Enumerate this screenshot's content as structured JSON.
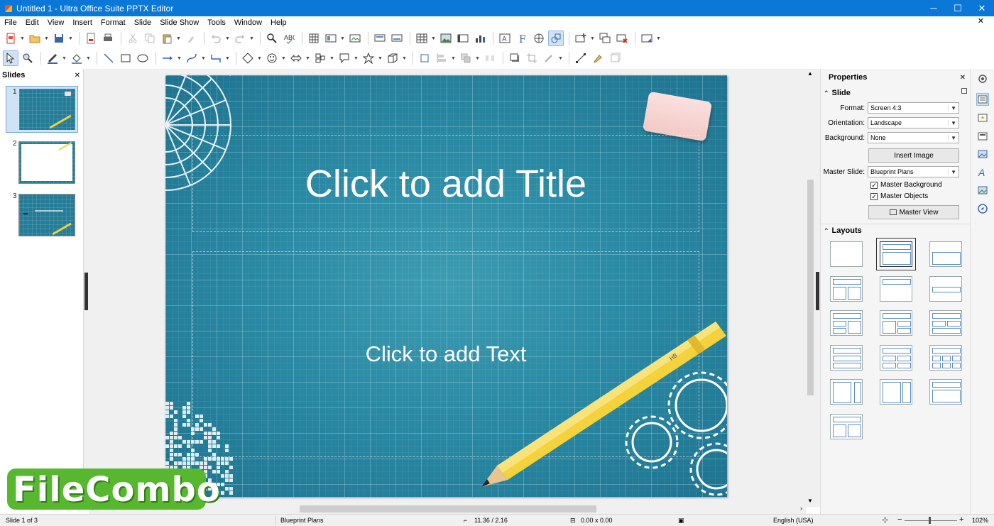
{
  "window": {
    "title": "Untitled 1 - Ultra Office Suite PPTX Editor",
    "minimize": "─",
    "maximize": "☐",
    "close": "✕"
  },
  "menu": {
    "items": [
      "File",
      "Edit",
      "View",
      "Insert",
      "Format",
      "Slide",
      "Slide Show",
      "Tools",
      "Window",
      "Help"
    ],
    "close": "✕"
  },
  "slides_pane": {
    "title": "Slides",
    "close": "✕",
    "thumbs": [
      {
        "number": "1"
      },
      {
        "number": "2"
      },
      {
        "number": "3"
      }
    ]
  },
  "slide": {
    "title_placeholder": "Click to add Title",
    "text_placeholder": "Click to add Text",
    "pencil_label": "HB"
  },
  "properties": {
    "title": "Properties",
    "close": "✕",
    "slide_section": "Slide",
    "format_label": "Format:",
    "format_value": "Screen 4:3",
    "orientation_label": "Orientation:",
    "orientation_value": "Landscape",
    "background_label": "Background:",
    "background_value": "None",
    "insert_image": "Insert Image",
    "master_slide_label": "Master Slide:",
    "master_slide_value": "Blueprint Plans",
    "master_background": "Master Background",
    "master_objects": "Master Objects",
    "master_view": "Master View",
    "layouts_section": "Layouts"
  },
  "status": {
    "slide_of": "Slide 1 of 3",
    "master": "Blueprint Plans",
    "position": "11.36 / 2.16",
    "size": "0.00 x 0.00",
    "language": "English (USA)",
    "zoom": "102%",
    "zoom_minus": "−",
    "zoom_plus": "+",
    "zoom_level": 0.47
  },
  "watermark": "FileCombo",
  "colors": {
    "titlebar": "#0b78d7",
    "slide_bg": "#2a8aa4",
    "selection": "#cfe3f7",
    "watermark_bg": "#57b82f"
  }
}
